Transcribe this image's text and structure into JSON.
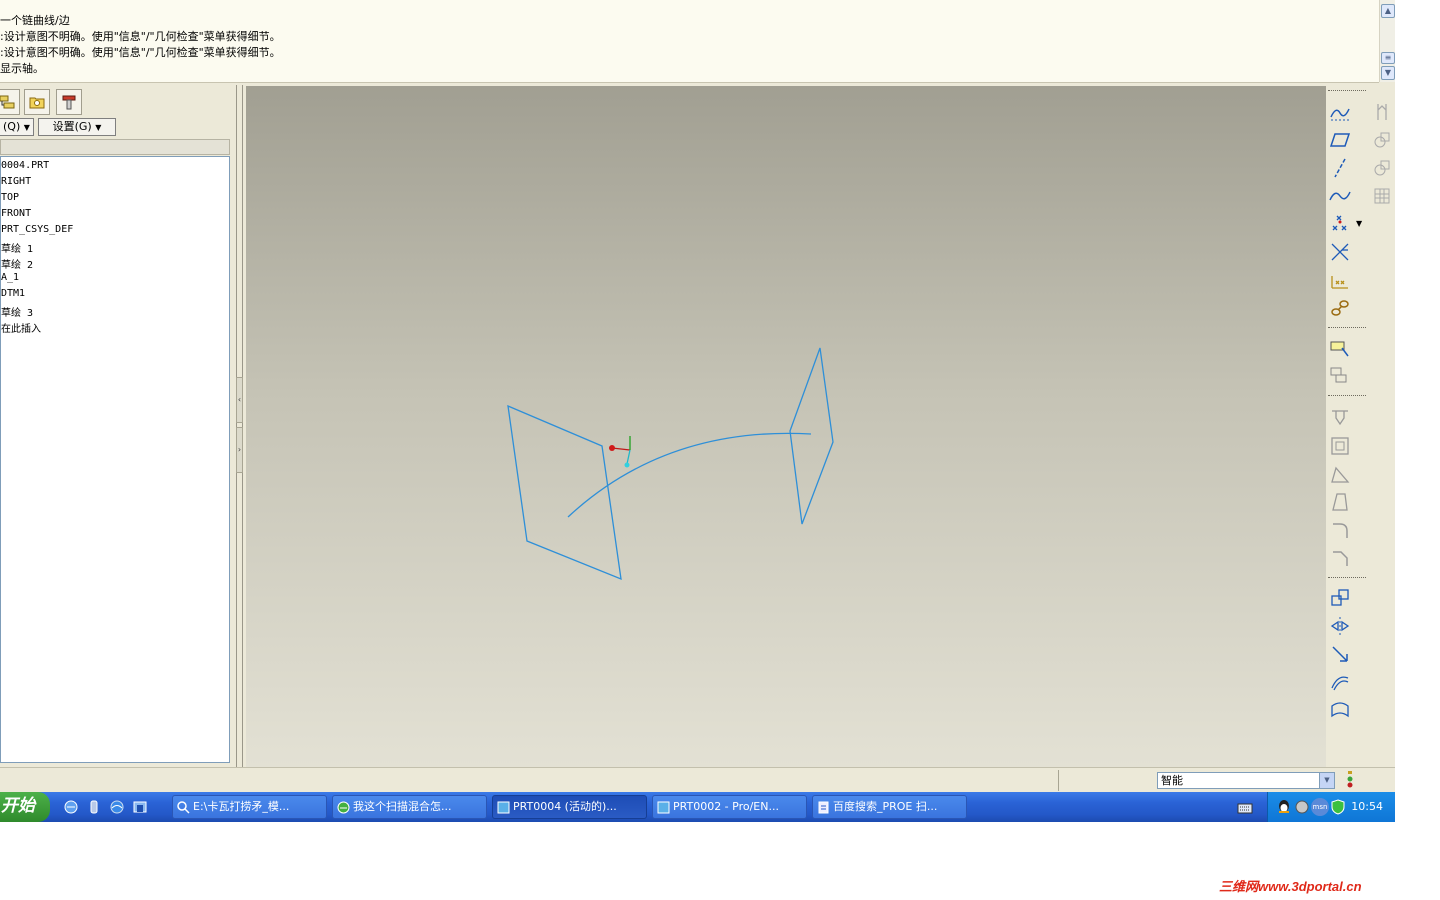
{
  "message_area": {
    "lines": [
      "一个链曲线/边",
      ":设计意图不明确。使用\"信息\"/\"几何检查\"菜单获得细节。",
      ":设计意图不明确。使用\"信息\"/\"几何检查\"菜单获得细节。",
      "显示轴。"
    ]
  },
  "model_tree": {
    "show_menu_label": "(Q)",
    "settings_label": "设置(G)",
    "items": [
      "0004.PRT",
      "RIGHT",
      "TOP",
      "FRONT",
      "PRT_CSYS_DEF",
      "草绘 1",
      "草绘 2",
      "A_1",
      "DTM1",
      "草绘 3",
      "在此插入"
    ]
  },
  "status": {
    "filter_value": "智能"
  },
  "taskbar": {
    "start_label": "开始",
    "tasks": [
      {
        "label": "E:\\卡瓦打捞矛_模..."
      },
      {
        "label": "我这个扫描混合怎..."
      },
      {
        "label": "PRT0004 (活动的)..."
      },
      {
        "label": "PRT0002 - Pro/EN..."
      },
      {
        "label": "百度搜索_PROE 扫..."
      }
    ],
    "clock": "10:54",
    "tray_msn": "msn"
  },
  "watermark": "三维网www.3dportal.cn",
  "colors": {
    "sketch_line": "#2e8fd8",
    "taskbar_blue": "#2458c8",
    "tray_blue": "#0f76d6",
    "start_green": "#3a9c36"
  },
  "icons": {
    "tab_icons": [
      "model-tree-icon",
      "folder-icon",
      "hammer-icon"
    ],
    "quick_launch": [
      "ie-icon",
      "desktop-icon",
      "media-icon",
      "messenger-icon"
    ],
    "right_toolbar": [
      "sketch-tool-icon",
      "plane-icon",
      "axis-icon",
      "curve-icon",
      "point-icon",
      "offset-point-icon",
      "csys-icon",
      "analysis-icon",
      "note-icon",
      "copy-icon",
      "hole-icon",
      "shell-icon",
      "rib-icon",
      "draft-icon",
      "round-icon",
      "chamfer-icon",
      "pattern-icon",
      "mirror-icon",
      "extend-icon",
      "offset-icon",
      "thicken-icon"
    ]
  }
}
